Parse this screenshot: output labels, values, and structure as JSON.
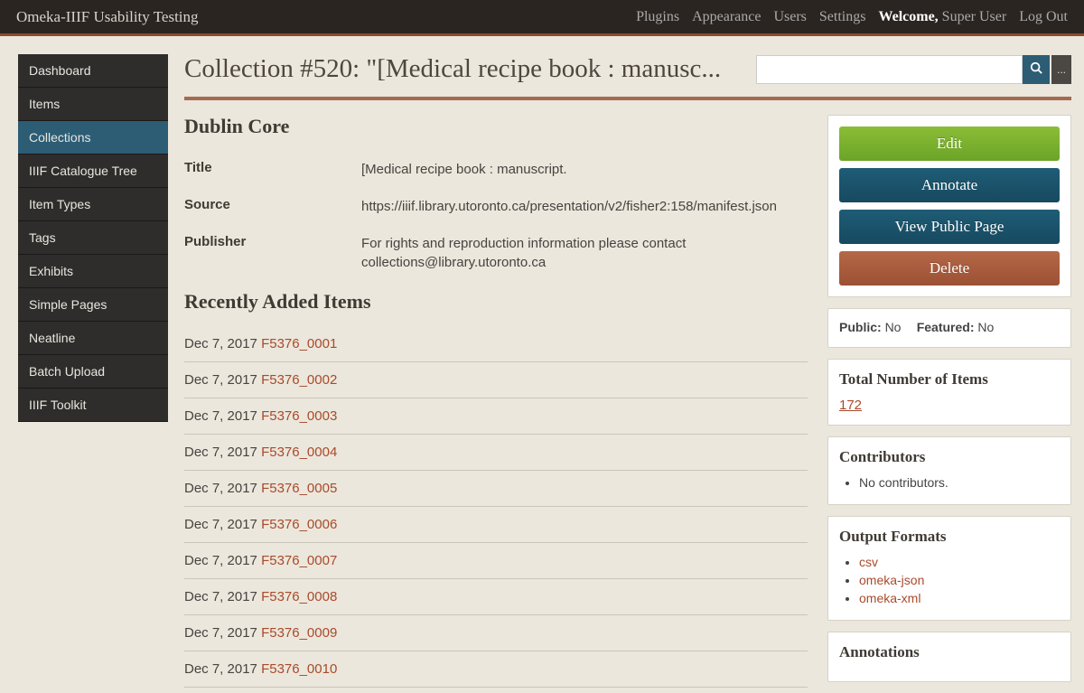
{
  "topbar": {
    "site_title": "Omeka-IIIF Usability Testing",
    "links": [
      "Plugins",
      "Appearance",
      "Users",
      "Settings"
    ],
    "welcome_label": "Welcome,",
    "welcome_user": "Super User",
    "logout": "Log Out"
  },
  "sidebar": {
    "items": [
      "Dashboard",
      "Items",
      "Collections",
      "IIIF Catalogue Tree",
      "Item Types",
      "Tags",
      "Exhibits",
      "Simple Pages",
      "Neatline",
      "Batch Upload",
      "IIIF Toolkit"
    ],
    "active_index": 2
  },
  "page": {
    "title": "Collection #520: \"[Medical recipe book : manusc..."
  },
  "search": {
    "value": "",
    "placeholder": "",
    "adv_label": "..."
  },
  "dublin_core": {
    "heading": "Dublin Core",
    "rows": [
      {
        "label": "Title",
        "value": "[Medical recipe book : manuscript."
      },
      {
        "label": "Source",
        "value": "https://iiif.library.utoronto.ca/presentation/v2/fisher2:158/manifest.json"
      },
      {
        "label": "Publisher",
        "value": "For rights and reproduction information please contact collections@library.utoronto.ca"
      }
    ]
  },
  "recent": {
    "heading": "Recently Added Items",
    "items": [
      {
        "date": "Dec 7, 2017",
        "title": "F5376_0001"
      },
      {
        "date": "Dec 7, 2017",
        "title": "F5376_0002"
      },
      {
        "date": "Dec 7, 2017",
        "title": "F5376_0003"
      },
      {
        "date": "Dec 7, 2017",
        "title": "F5376_0004"
      },
      {
        "date": "Dec 7, 2017",
        "title": "F5376_0005"
      },
      {
        "date": "Dec 7, 2017",
        "title": "F5376_0006"
      },
      {
        "date": "Dec 7, 2017",
        "title": "F5376_0007"
      },
      {
        "date": "Dec 7, 2017",
        "title": "F5376_0008"
      },
      {
        "date": "Dec 7, 2017",
        "title": "F5376_0009"
      },
      {
        "date": "Dec 7, 2017",
        "title": "F5376_0010"
      }
    ]
  },
  "actions": {
    "edit": "Edit",
    "annotate": "Annotate",
    "view_public": "View Public Page",
    "delete": "Delete"
  },
  "status": {
    "public_label": "Public:",
    "public_value": "No",
    "featured_label": "Featured:",
    "featured_value": "No"
  },
  "totals": {
    "heading": "Total Number of Items",
    "value": "172"
  },
  "contributors": {
    "heading": "Contributors",
    "none": "No contributors."
  },
  "formats": {
    "heading": "Output Formats",
    "items": [
      "csv",
      "omeka-json",
      "omeka-xml"
    ]
  },
  "annotations": {
    "heading": "Annotations"
  }
}
